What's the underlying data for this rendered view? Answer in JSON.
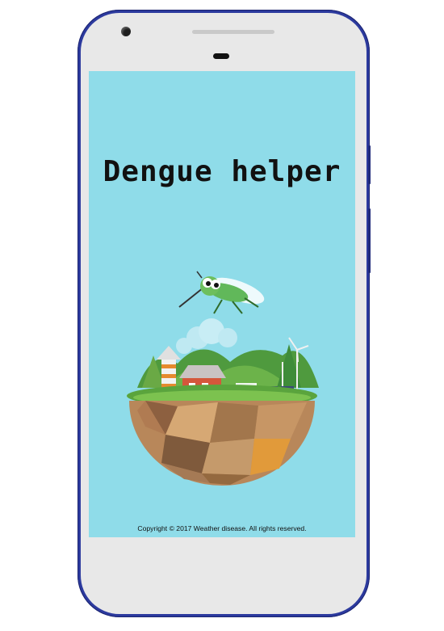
{
  "app": {
    "title": "Dengue helper",
    "copyright": "Copyright © 2017 Weather disease. All rights reserved."
  },
  "icons": {
    "mosquito": "mosquito-icon",
    "globe": "island-globe-icon",
    "camera": "front-camera-icon"
  },
  "colors": {
    "screen_bg": "#8fdce9",
    "phone_frame": "#2c3a9e",
    "phone_body": "#e8e8e8"
  }
}
